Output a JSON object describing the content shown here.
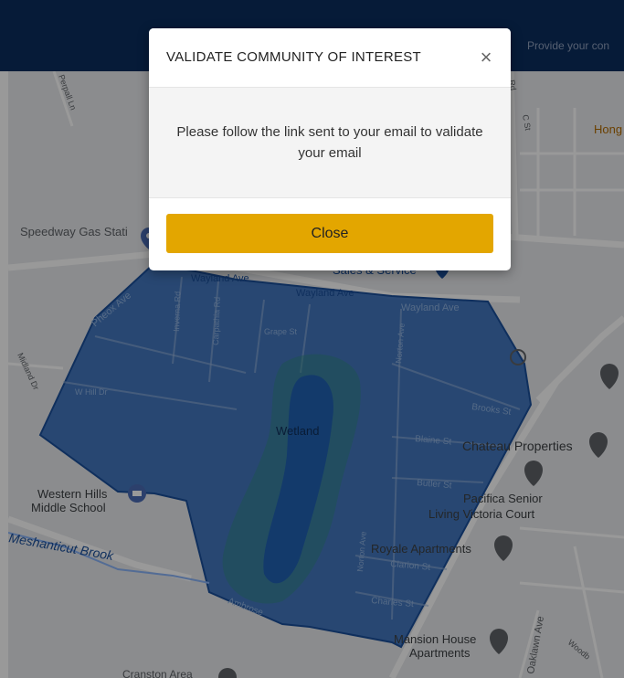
{
  "header": {
    "hint_text": "Provide your con"
  },
  "modal": {
    "title": "VALIDATE COMMUNITY OF INTEREST",
    "close_icon": "×",
    "message": "Please follow the link sent to your email to validate your email",
    "close_button_label": "Close",
    "button_color": "#e3a600"
  },
  "map": {
    "streets": [
      "Wayland Ave",
      "Wayland Ave",
      "Wayland Ave",
      "Grape St",
      "Inverna Rd",
      "Carpathia Rd",
      "W Hill Dr",
      "Norton Ave",
      "Norton Ave",
      "Brooks St",
      "Blaine St",
      "Butler St",
      "Clarion St",
      "Charles St",
      "Ambrose",
      "Midland Dr",
      "Pheox Ave",
      "Oaklawn Ave",
      "C St",
      "Woodb",
      "Rd",
      "Perpall Ln"
    ],
    "places": [
      "Speedway Gas Stati",
      "Wetland",
      "Chateau Properties",
      "Western Hills",
      "Middle School",
      "Pacifica Senior",
      "Living Victoria Court",
      "Royale Apartments",
      "Mansion House",
      "Apartments",
      "Sales & Service",
      "Hong",
      "Meshanticut Brook",
      "Cranston Area"
    ],
    "area_color": "#2b6fc4"
  }
}
